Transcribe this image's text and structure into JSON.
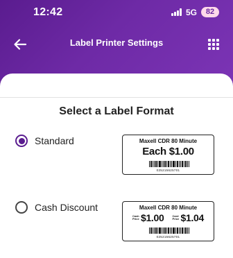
{
  "status_bar": {
    "time": "12:42",
    "network": "5G",
    "battery": "82"
  },
  "app_bar": {
    "title": "Label Printer Settings",
    "back_icon": "arrow-left-icon",
    "menu_icon": "grid-icon"
  },
  "section": {
    "title": "Select a Label Format"
  },
  "options": [
    {
      "label": "Standard",
      "selected": true,
      "preview": {
        "product": "Maxell CDR 80 Minute",
        "price_text": "Each $1.00",
        "upc": "025215625701"
      }
    },
    {
      "label": "Cash Discount",
      "selected": false,
      "preview": {
        "product": "Maxell CDR 80 Minute",
        "cash_label": "Cash Price",
        "cash_price": "$1.00",
        "card_label": "Card Price",
        "card_price": "$1.04",
        "upc": "025215625701"
      }
    }
  ],
  "colors": {
    "brand": "#6b2aa3",
    "brand_dark": "#5a1c8f",
    "battery_bg": "#ffd9ea"
  }
}
